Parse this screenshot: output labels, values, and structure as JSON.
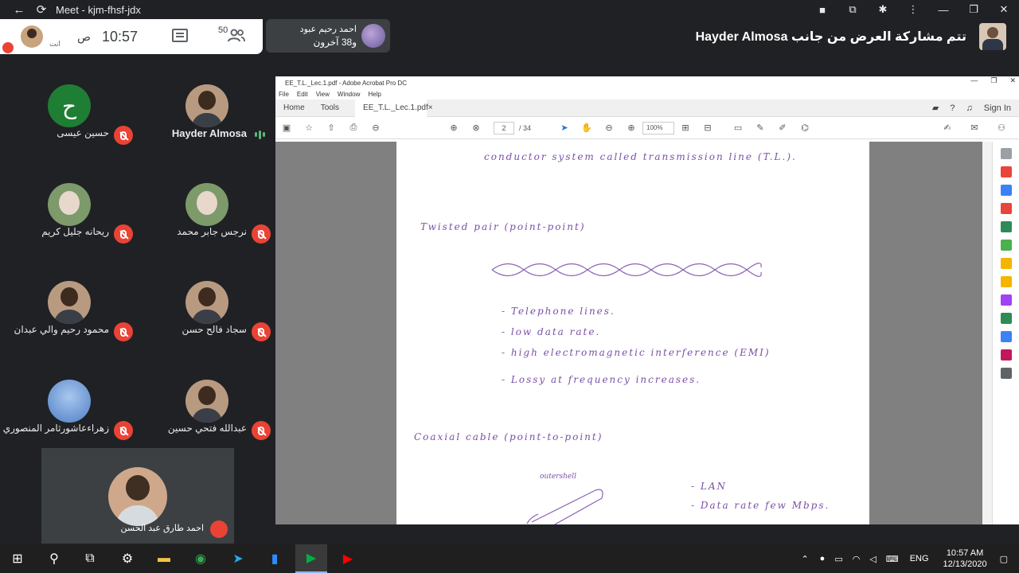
{
  "browser": {
    "title": "Meet - kjm-fhsf-jdx"
  },
  "meet": {
    "time": "10:57",
    "ampm": "ص",
    "you_label": "انت",
    "participant_count": "50",
    "presenter_chip": {
      "name": "احمد رحيم عبود",
      "others": "و38 آخرون"
    },
    "presenting_banner": "تتم مشاركة العرض من جانب Hayder Almosa"
  },
  "participants": [
    {
      "name": "Hayder Almosa",
      "speaking": true,
      "avatar": "photo"
    },
    {
      "name": "حسين عيسى",
      "speaking": false,
      "avatar": "letter",
      "letter": "ح"
    },
    {
      "name": "نرجس جابر محمد",
      "speaking": false,
      "avatar": "hijab"
    },
    {
      "name": "ريحانه جليل كريم",
      "speaking": false,
      "avatar": "hijab"
    },
    {
      "name": "سجاد فالح حسن",
      "speaking": false,
      "avatar": "photo"
    },
    {
      "name": "محمود رحيم والي عبدان",
      "speaking": false,
      "avatar": "photo"
    },
    {
      "name": "عبدالله فتحي حسين",
      "speaking": false,
      "avatar": "photo"
    },
    {
      "name": "زهراءعاشورثامر المنصوري",
      "speaking": false,
      "avatar": "blue"
    }
  ],
  "bottom_participant": {
    "name": "احمد طارق عبد الحسن"
  },
  "acrobat": {
    "window_title": "EE_T.L._Lec.1.pdf - Adobe Acrobat Pro DC",
    "menu": [
      "File",
      "Edit",
      "View",
      "Window",
      "Help"
    ],
    "tabs": {
      "home": "Home",
      "tools": "Tools",
      "doc": "EE_T.L._Lec.1.pdf"
    },
    "sign_in": "Sign In",
    "page_current": "2",
    "page_total": "/ 34",
    "zoom": "100%"
  },
  "notes": {
    "line0": "conductor system called transmission line (T.L.).",
    "h1": "Twisted pair (point-point)",
    "b1": "- Telephone lines.",
    "b2": "- low data rate.",
    "b3": "- high electromagnetic interference (EMI)",
    "b4": "- Lossy at frequency increases.",
    "h2": "Coaxial cable (point-to-point)",
    "outer_shell": "outershell",
    "c1": "- LAN",
    "c2": "- Data rate few Mbps."
  },
  "taskbar": {
    "lang": "ENG",
    "time": "10:57 AM",
    "date": "12/13/2020"
  }
}
